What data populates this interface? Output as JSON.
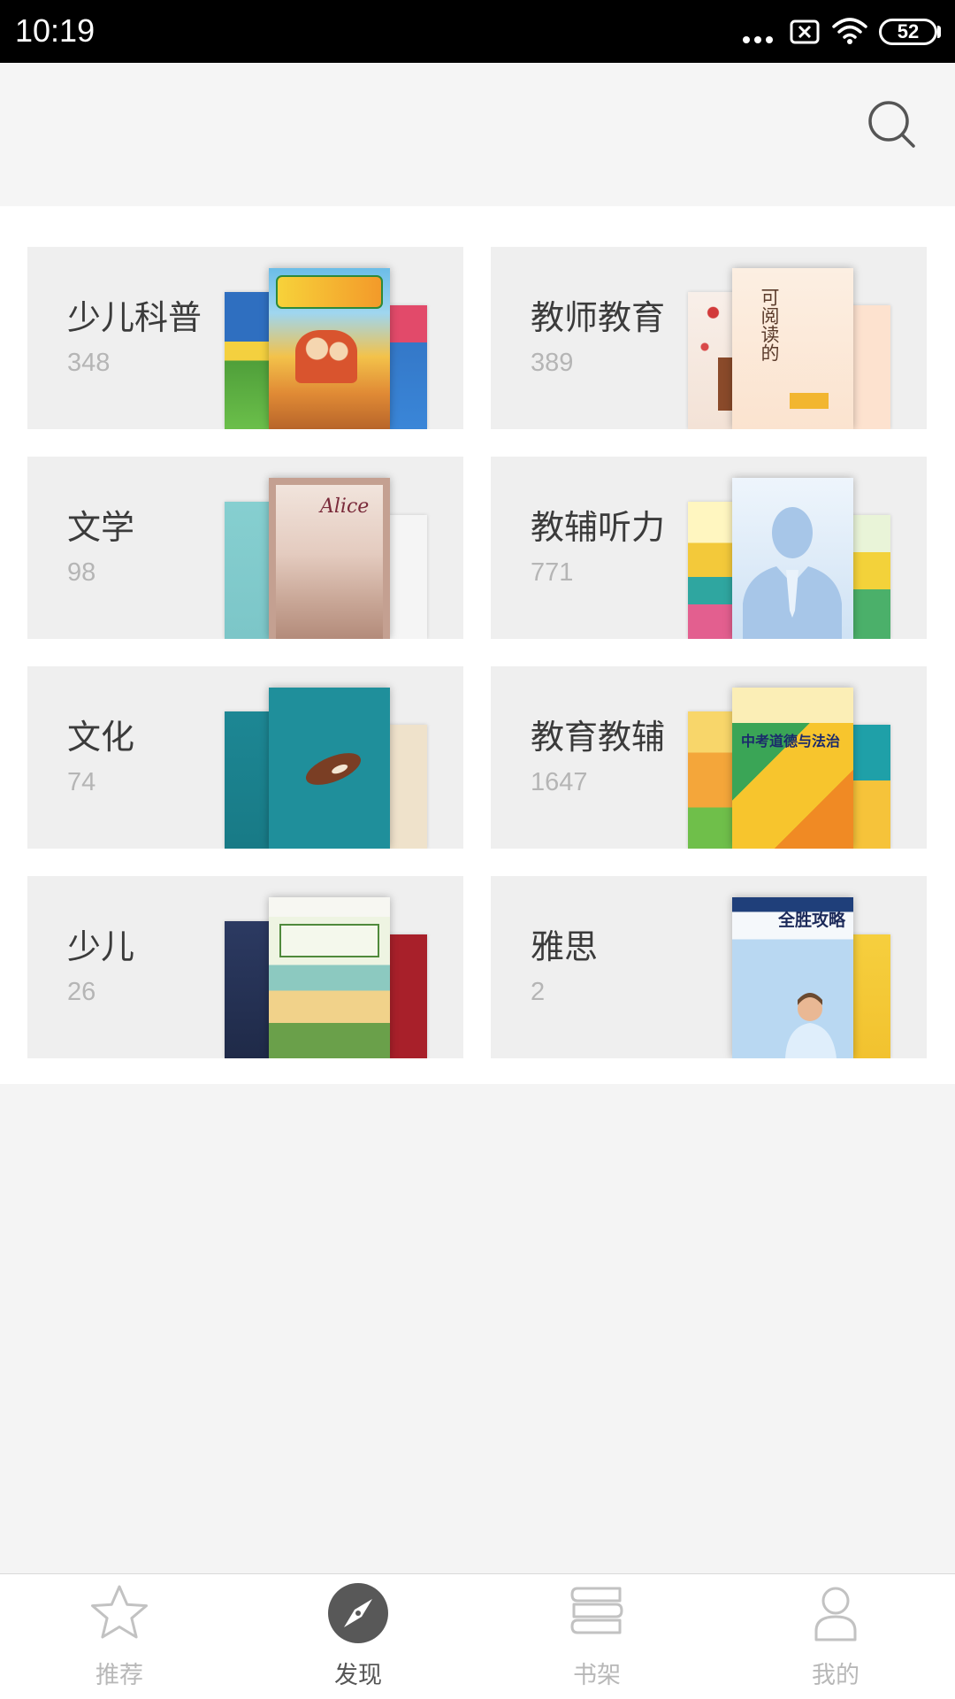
{
  "status_bar": {
    "time": "10:19",
    "battery_level": "52",
    "icons": [
      "more-dots-icon",
      "no-sim-icon",
      "wifi-icon",
      "battery-icon"
    ]
  },
  "header": {
    "search_icon": "search-icon"
  },
  "categories": [
    {
      "title": "少儿科普",
      "count": "348"
    },
    {
      "title": "教师教育",
      "count": "389",
      "cover_text": "可阅读的"
    },
    {
      "title": "文学",
      "count": "98",
      "cover_text": "Alice"
    },
    {
      "title": "教辅听力",
      "count": "771"
    },
    {
      "title": "文化",
      "count": "74"
    },
    {
      "title": "教育教辅",
      "count": "1647",
      "cover_text": "中考道德与法治"
    },
    {
      "title": "少儿",
      "count": "26"
    },
    {
      "title": "雅思",
      "count": "2",
      "cover_text": "全胜攻略"
    }
  ],
  "bottom_nav": {
    "tabs": [
      {
        "label": "推荐",
        "icon": "star-icon",
        "active": false
      },
      {
        "label": "发现",
        "icon": "compass-icon",
        "active": true
      },
      {
        "label": "书架",
        "icon": "bookshelf-icon",
        "active": false
      },
      {
        "label": "我的",
        "icon": "person-icon",
        "active": false
      }
    ]
  },
  "colors": {
    "status_bar": "#000000",
    "header_bg": "#f5f5f5",
    "card_bg": "#efefef",
    "title_text": "#3b3b3b",
    "count_text": "#b5b5b5",
    "nav_active": "#555555",
    "nav_inactive": "#b8b8b8"
  }
}
